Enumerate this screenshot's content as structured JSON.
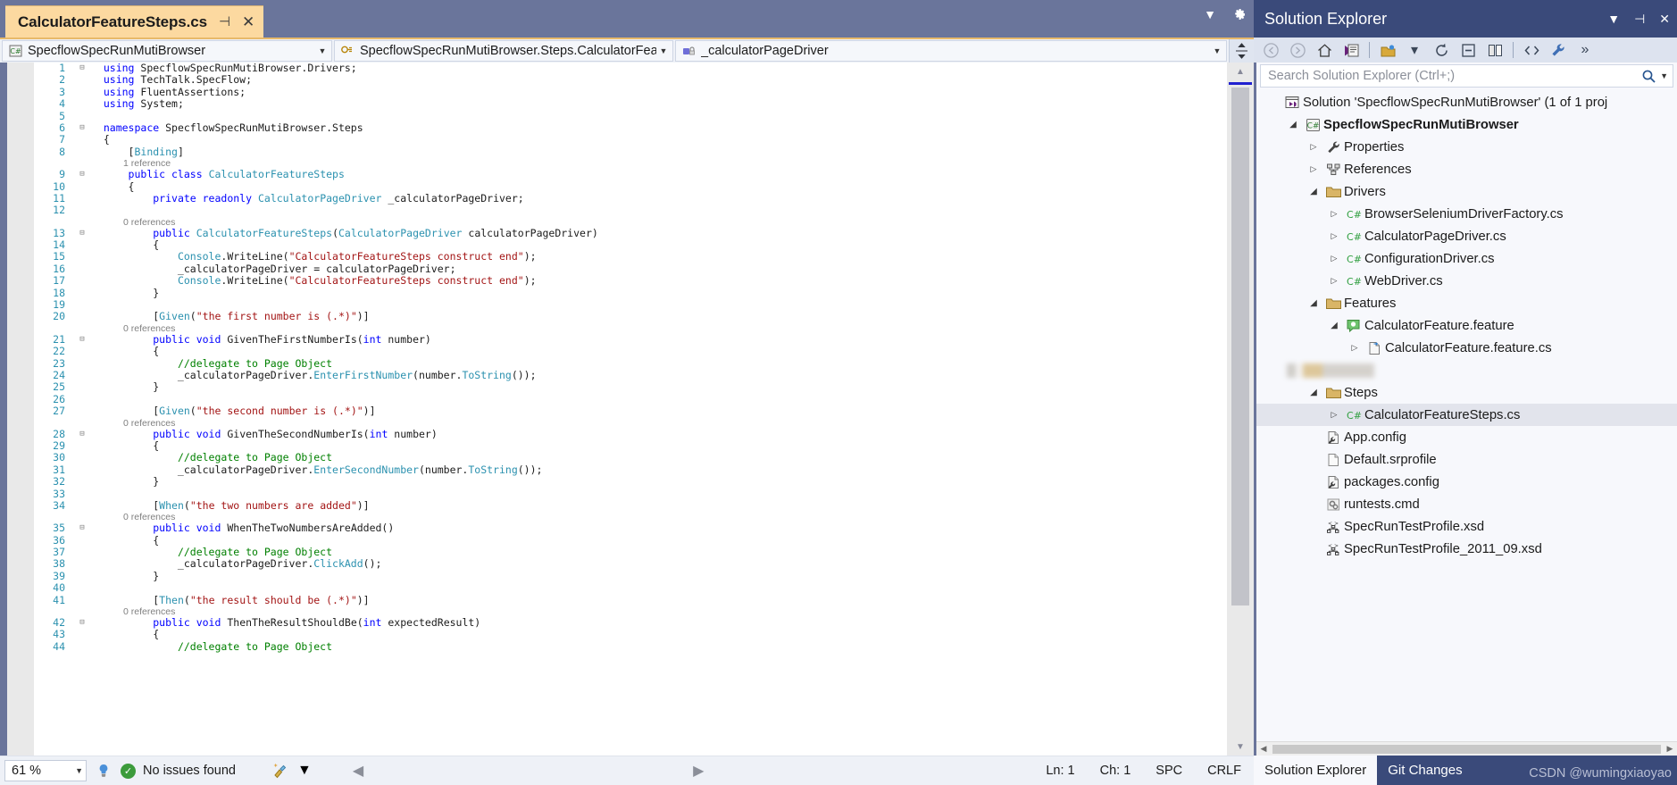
{
  "editor": {
    "tab": {
      "title": "CalculatorFeatureSteps.cs",
      "pin_icon": "pin-icon",
      "close_icon": "close-icon"
    },
    "tabbar": {
      "dropdown_icon": "chevron-down-icon",
      "settings_icon": "gear-icon"
    },
    "navbar": {
      "project": "SpecflowSpecRunMutiBrowser",
      "type": "SpecflowSpecRunMutiBrowser.Steps.CalculatorFea",
      "member": "_calculatorPageDriver",
      "split_icon": "split-view-icon"
    },
    "lines": [
      {
        "n": 1,
        "fold": "-",
        "tokens": [
          [
            "pln",
            "  "
          ],
          [
            "kw",
            "using"
          ],
          [
            "pln",
            " SpecflowSpecRunMutiBrowser.Drivers;"
          ]
        ]
      },
      {
        "n": 2,
        "fold": "",
        "tokens": [
          [
            "pln",
            "  "
          ],
          [
            "kw",
            "using"
          ],
          [
            "pln",
            " TechTalk.SpecFlow;"
          ]
        ]
      },
      {
        "n": 3,
        "fold": "",
        "tokens": [
          [
            "pln",
            "  "
          ],
          [
            "kw",
            "using"
          ],
          [
            "pln",
            " FluentAssertions;"
          ]
        ]
      },
      {
        "n": 4,
        "fold": "",
        "tokens": [
          [
            "pln",
            "  "
          ],
          [
            "kw",
            "using"
          ],
          [
            "pln",
            " System;"
          ]
        ]
      },
      {
        "n": 5,
        "fold": "",
        "tokens": []
      },
      {
        "n": 6,
        "fold": "-",
        "tokens": [
          [
            "pln",
            "  "
          ],
          [
            "kw",
            "namespace"
          ],
          [
            "pln",
            " SpecflowSpecRunMutiBrowser.Steps"
          ]
        ]
      },
      {
        "n": 7,
        "fold": "",
        "tokens": [
          [
            "pln",
            "  {"
          ]
        ]
      },
      {
        "n": 8,
        "fold": "",
        "tokens": [
          [
            "pln",
            "      ["
          ],
          [
            "attr",
            "Binding"
          ],
          [
            "pln",
            "]"
          ]
        ]
      },
      {
        "ref": "1 reference"
      },
      {
        "n": 9,
        "fold": "-",
        "tokens": [
          [
            "pln",
            "      "
          ],
          [
            "kw",
            "public class"
          ],
          [
            "pln",
            " "
          ],
          [
            "typ",
            "CalculatorFeatureSteps"
          ]
        ]
      },
      {
        "n": 10,
        "fold": "",
        "tokens": [
          [
            "pln",
            "      {"
          ]
        ]
      },
      {
        "n": 11,
        "fold": "",
        "tokens": [
          [
            "pln",
            "          "
          ],
          [
            "kw",
            "private readonly"
          ],
          [
            "pln",
            " "
          ],
          [
            "typ",
            "CalculatorPageDriver"
          ],
          [
            "pln",
            " _calculatorPageDriver;"
          ]
        ]
      },
      {
        "n": 12,
        "fold": "",
        "tokens": []
      },
      {
        "ref": "0 references"
      },
      {
        "n": 13,
        "fold": "-",
        "tokens": [
          [
            "pln",
            "          "
          ],
          [
            "kw",
            "public"
          ],
          [
            "pln",
            " "
          ],
          [
            "typ",
            "CalculatorFeatureSteps"
          ],
          [
            "pln",
            "("
          ],
          [
            "typ",
            "CalculatorPageDriver"
          ],
          [
            "pln",
            " calculatorPageDriver)"
          ]
        ]
      },
      {
        "n": 14,
        "fold": "",
        "tokens": [
          [
            "pln",
            "          {"
          ]
        ]
      },
      {
        "n": 15,
        "fold": "",
        "tokens": [
          [
            "pln",
            "              "
          ],
          [
            "typ",
            "Console"
          ],
          [
            "pln",
            ".WriteLine("
          ],
          [
            "str",
            "\"CalculatorFeatureSteps construct end\""
          ],
          [
            "pln",
            ");"
          ]
        ]
      },
      {
        "n": 16,
        "fold": "",
        "tokens": [
          [
            "pln",
            "              _calculatorPageDriver = calculatorPageDriver;"
          ]
        ]
      },
      {
        "n": 17,
        "fold": "",
        "tokens": [
          [
            "pln",
            "              "
          ],
          [
            "typ",
            "Console"
          ],
          [
            "pln",
            ".WriteLine("
          ],
          [
            "str",
            "\"CalculatorFeatureSteps construct end\""
          ],
          [
            "pln",
            ");"
          ]
        ]
      },
      {
        "n": 18,
        "fold": "",
        "tokens": [
          [
            "pln",
            "          }"
          ]
        ]
      },
      {
        "n": 19,
        "fold": "",
        "tokens": []
      },
      {
        "n": 20,
        "fold": "",
        "tokens": [
          [
            "pln",
            "          ["
          ],
          [
            "attr",
            "Given"
          ],
          [
            "pln",
            "("
          ],
          [
            "str",
            "\"the first number is (.*)\""
          ],
          [
            "pln",
            ")]"
          ]
        ]
      },
      {
        "ref": "0 references"
      },
      {
        "n": 21,
        "fold": "-",
        "tokens": [
          [
            "pln",
            "          "
          ],
          [
            "kw",
            "public void"
          ],
          [
            "pln",
            " GivenTheFirstNumberIs("
          ],
          [
            "kw",
            "int"
          ],
          [
            "pln",
            " number)"
          ]
        ]
      },
      {
        "n": 22,
        "fold": "",
        "tokens": [
          [
            "pln",
            "          {"
          ]
        ]
      },
      {
        "n": 23,
        "fold": "",
        "tokens": [
          [
            "pln",
            "              "
          ],
          [
            "cmt",
            "//delegate to Page Object"
          ]
        ]
      },
      {
        "n": 24,
        "fold": "",
        "tokens": [
          [
            "pln",
            "              _calculatorPageDriver"
          ],
          [
            "pln",
            "."
          ],
          [
            "typ",
            "EnterFirstNumber"
          ],
          [
            "pln",
            "(number."
          ],
          [
            "typ",
            "ToString"
          ],
          [
            "pln",
            "());"
          ]
        ]
      },
      {
        "n": 25,
        "fold": "",
        "tokens": [
          [
            "pln",
            "          }"
          ]
        ]
      },
      {
        "n": 26,
        "fold": "",
        "tokens": []
      },
      {
        "n": 27,
        "fold": "",
        "tokens": [
          [
            "pln",
            "          ["
          ],
          [
            "attr",
            "Given"
          ],
          [
            "pln",
            "("
          ],
          [
            "str",
            "\"the second number is (.*)\""
          ],
          [
            "pln",
            ")]"
          ]
        ]
      },
      {
        "ref": "0 references"
      },
      {
        "n": 28,
        "fold": "-",
        "tokens": [
          [
            "pln",
            "          "
          ],
          [
            "kw",
            "public void"
          ],
          [
            "pln",
            " GivenTheSecondNumberIs("
          ],
          [
            "kw",
            "int"
          ],
          [
            "pln",
            " number)"
          ]
        ]
      },
      {
        "n": 29,
        "fold": "",
        "tokens": [
          [
            "pln",
            "          {"
          ]
        ]
      },
      {
        "n": 30,
        "fold": "",
        "tokens": [
          [
            "pln",
            "              "
          ],
          [
            "cmt",
            "//delegate to Page Object"
          ]
        ]
      },
      {
        "n": 31,
        "fold": "",
        "tokens": [
          [
            "pln",
            "              _calculatorPageDriver"
          ],
          [
            "pln",
            "."
          ],
          [
            "typ",
            "EnterSecondNumber"
          ],
          [
            "pln",
            "(number."
          ],
          [
            "typ",
            "ToString"
          ],
          [
            "pln",
            "());"
          ]
        ]
      },
      {
        "n": 32,
        "fold": "",
        "tokens": [
          [
            "pln",
            "          }"
          ]
        ]
      },
      {
        "n": 33,
        "fold": "",
        "tokens": []
      },
      {
        "n": 34,
        "fold": "",
        "tokens": [
          [
            "pln",
            "          ["
          ],
          [
            "attr",
            "When"
          ],
          [
            "pln",
            "("
          ],
          [
            "str",
            "\"the two numbers are added\""
          ],
          [
            "pln",
            ")]"
          ]
        ]
      },
      {
        "ref": "0 references"
      },
      {
        "n": 35,
        "fold": "-",
        "tokens": [
          [
            "pln",
            "          "
          ],
          [
            "kw",
            "public void"
          ],
          [
            "pln",
            " WhenTheTwoNumbersAreAdded()"
          ]
        ]
      },
      {
        "n": 36,
        "fold": "",
        "tokens": [
          [
            "pln",
            "          {"
          ]
        ]
      },
      {
        "n": 37,
        "fold": "",
        "tokens": [
          [
            "pln",
            "              "
          ],
          [
            "cmt",
            "//delegate to Page Object"
          ]
        ]
      },
      {
        "n": 38,
        "fold": "",
        "tokens": [
          [
            "pln",
            "              _calculatorPageDriver"
          ],
          [
            "pln",
            "."
          ],
          [
            "typ",
            "ClickAdd"
          ],
          [
            "pln",
            "();"
          ]
        ]
      },
      {
        "n": 39,
        "fold": "",
        "tokens": [
          [
            "pln",
            "          }"
          ]
        ]
      },
      {
        "n": 40,
        "fold": "",
        "tokens": []
      },
      {
        "n": 41,
        "fold": "",
        "tokens": [
          [
            "pln",
            "          ["
          ],
          [
            "attr",
            "Then"
          ],
          [
            "pln",
            "("
          ],
          [
            "str",
            "\"the result should be (.*)\""
          ],
          [
            "pln",
            ")]"
          ]
        ]
      },
      {
        "ref": "0 references"
      },
      {
        "n": 42,
        "fold": "-",
        "tokens": [
          [
            "pln",
            "          "
          ],
          [
            "kw",
            "public void"
          ],
          [
            "pln",
            " ThenTheResultShouldBe("
          ],
          [
            "kw",
            "int"
          ],
          [
            "pln",
            " expectedResult)"
          ]
        ]
      },
      {
        "n": 43,
        "fold": "",
        "tokens": [
          [
            "pln",
            "          {"
          ]
        ]
      },
      {
        "n": 44,
        "fold": "",
        "tokens": [
          [
            "pln",
            "              "
          ],
          [
            "cmt",
            "//delegate to Page Object"
          ]
        ]
      }
    ]
  },
  "status": {
    "zoom": "61 %",
    "zoom_arrow_icon": "chevron-down-icon",
    "bulb_icon": "intellisense-icon",
    "issues_icon": "check-circle-icon",
    "issues": "No issues found",
    "broom_icon": "code-cleanup-icon",
    "broom_arrow_icon": "chevron-down-icon",
    "prev_icon": "prev-issue-icon",
    "next_icon": "next-issue-icon",
    "ln": "Ln: 1",
    "ch": "Ch: 1",
    "spc": "SPC",
    "crlf": "CRLF"
  },
  "solution_explorer": {
    "title": "Solution Explorer",
    "title_controls": [
      "chevron-down-icon",
      "pin-icon",
      "close-icon"
    ],
    "toolbar": [
      "back-icon",
      "forward-icon",
      "home-icon",
      "pending-changes-icon",
      "show-all-files-icon",
      "chevron-down-icon",
      "refresh-icon",
      "collapse-all-icon",
      "properties-icon",
      "view-code-icon",
      "settings-wrench-icon",
      "overflow-icon"
    ],
    "search": {
      "placeholder": "Search Solution Explorer (Ctrl+;)",
      "search_icon": "magnifier-icon",
      "dropdown_icon": "chevron-down-icon"
    },
    "tree": [
      {
        "label": "Solution 'SpecflowSpecRunMutiBrowser' (1 of 1 proj",
        "indent": 0,
        "expander": "",
        "icon": "solution-icon",
        "bold": false,
        "selected": false
      },
      {
        "label": "SpecflowSpecRunMutiBrowser",
        "indent": 1,
        "expander": "expanded",
        "icon": "csharp-project-icon",
        "bold": true,
        "selected": false
      },
      {
        "label": "Properties",
        "indent": 2,
        "expander": "collapsed",
        "icon": "wrench-icon",
        "bold": false,
        "selected": false
      },
      {
        "label": "References",
        "indent": 2,
        "expander": "collapsed",
        "icon": "references-icon",
        "bold": false,
        "selected": false
      },
      {
        "label": "Drivers",
        "indent": 2,
        "expander": "expanded",
        "icon": "folder-icon",
        "bold": false,
        "selected": false
      },
      {
        "label": "BrowserSeleniumDriverFactory.cs",
        "indent": 3,
        "expander": "collapsed",
        "icon": "csharp-file-icon",
        "bold": false,
        "selected": false
      },
      {
        "label": "CalculatorPageDriver.cs",
        "indent": 3,
        "expander": "collapsed",
        "icon": "csharp-file-icon",
        "bold": false,
        "selected": false
      },
      {
        "label": "ConfigurationDriver.cs",
        "indent": 3,
        "expander": "collapsed",
        "icon": "csharp-file-icon",
        "bold": false,
        "selected": false
      },
      {
        "label": "WebDriver.cs",
        "indent": 3,
        "expander": "collapsed",
        "icon": "csharp-file-icon",
        "bold": false,
        "selected": false
      },
      {
        "label": "Features",
        "indent": 2,
        "expander": "expanded",
        "icon": "folder-icon",
        "bold": false,
        "selected": false
      },
      {
        "label": "CalculatorFeature.feature",
        "indent": 3,
        "expander": "expanded",
        "icon": "feature-icon",
        "bold": false,
        "selected": false
      },
      {
        "label": "CalculatorFeature.feature.cs",
        "indent": 4,
        "expander": "collapsed",
        "icon": "generated-file-icon",
        "bold": false,
        "selected": false
      },
      {
        "label": "",
        "indent": 2,
        "expander": "",
        "icon": "redacted",
        "bold": false,
        "selected": false
      },
      {
        "label": "Steps",
        "indent": 2,
        "expander": "expanded",
        "icon": "folder-icon",
        "bold": false,
        "selected": false
      },
      {
        "label": "CalculatorFeatureSteps.cs",
        "indent": 3,
        "expander": "collapsed",
        "icon": "csharp-file-icon",
        "bold": false,
        "selected": true
      },
      {
        "label": "App.config",
        "indent": 2,
        "expander": "",
        "icon": "config-icon",
        "bold": false,
        "selected": false
      },
      {
        "label": "Default.srprofile",
        "indent": 2,
        "expander": "",
        "icon": "blank-file-icon",
        "bold": false,
        "selected": false
      },
      {
        "label": "packages.config",
        "indent": 2,
        "expander": "",
        "icon": "config-icon",
        "bold": false,
        "selected": false
      },
      {
        "label": "runtests.cmd",
        "indent": 2,
        "expander": "",
        "icon": "cmd-file-icon",
        "bold": false,
        "selected": false
      },
      {
        "label": "SpecRunTestProfile.xsd",
        "indent": 2,
        "expander": "",
        "icon": "xsd-file-icon",
        "bold": false,
        "selected": false
      },
      {
        "label": "SpecRunTestProfile_2011_09.xsd",
        "indent": 2,
        "expander": "",
        "icon": "xsd-file-icon",
        "bold": false,
        "selected": false
      }
    ],
    "tabs": [
      {
        "label": "Solution Explorer",
        "active": true
      },
      {
        "label": "Git Changes",
        "active": false
      }
    ],
    "watermark": "CSDN @wumingxiaoyao"
  }
}
